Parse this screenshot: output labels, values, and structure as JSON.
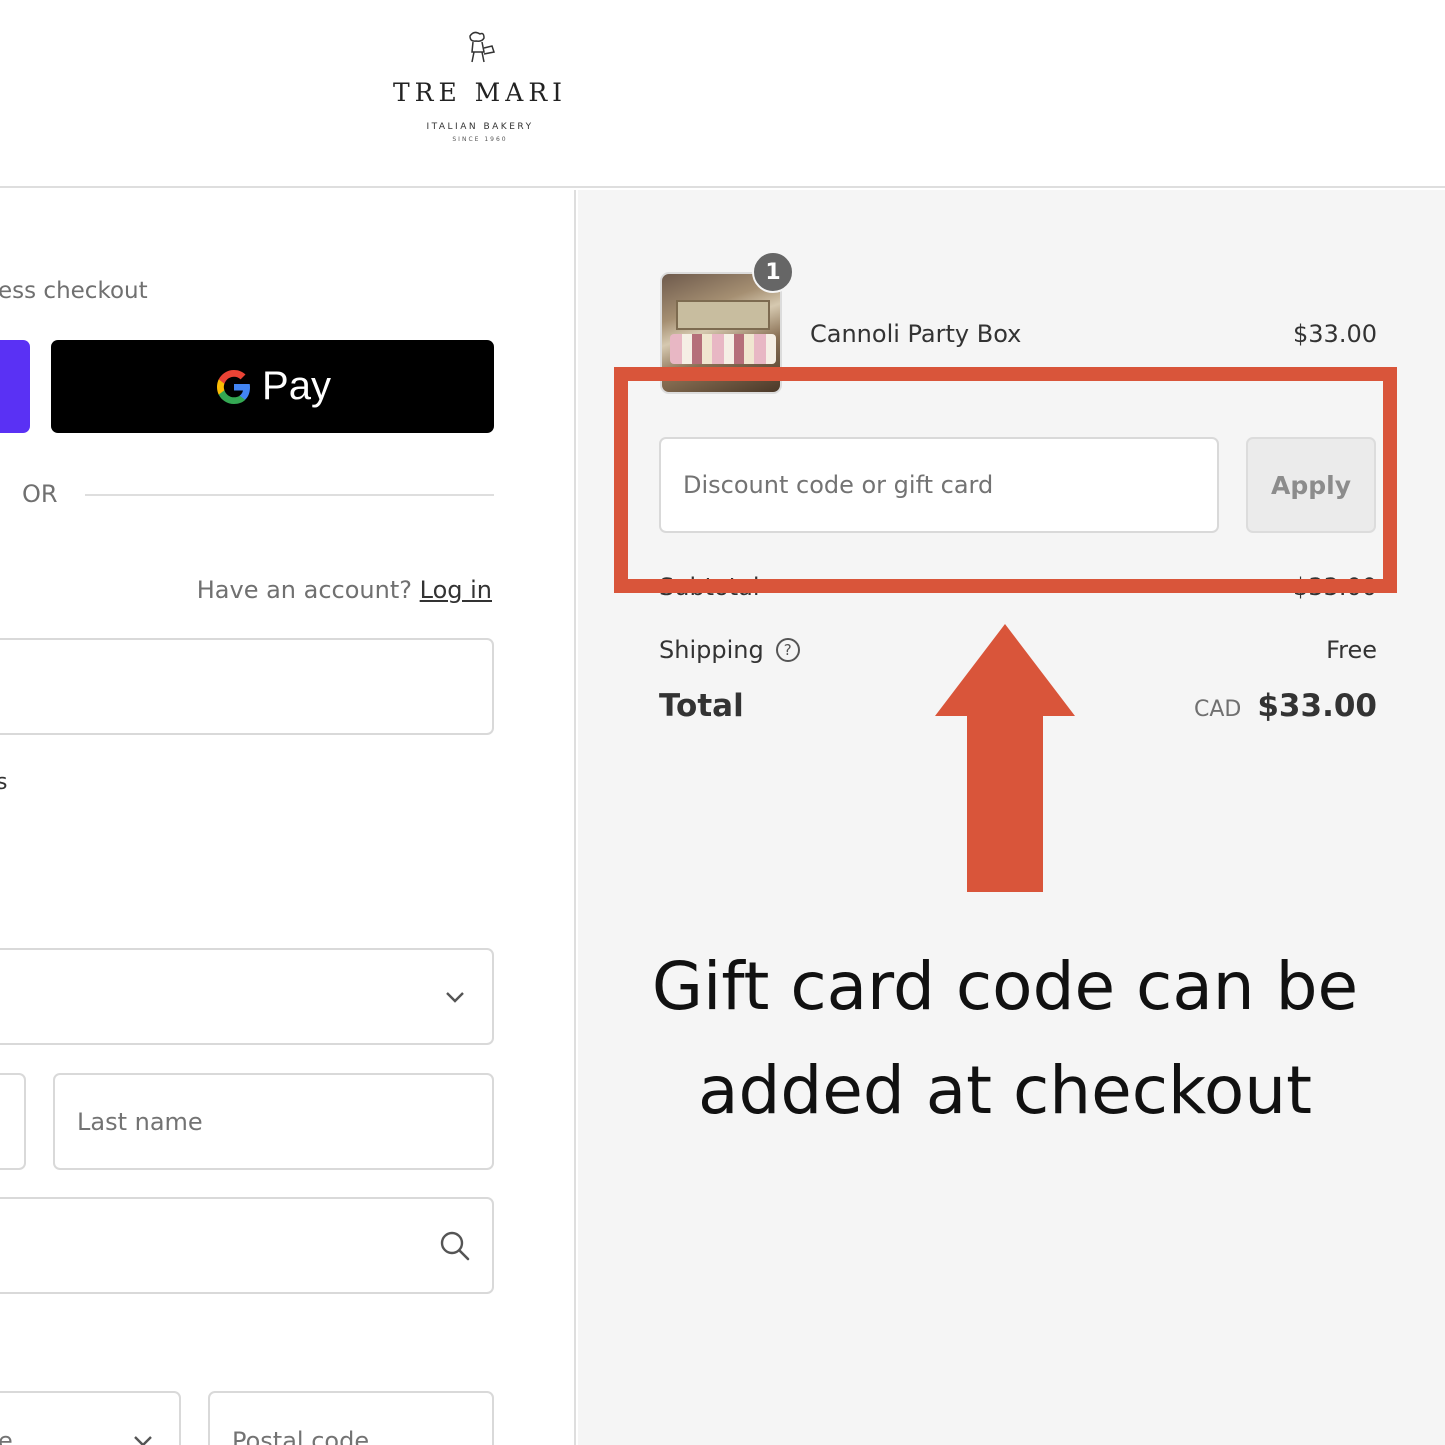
{
  "brand": {
    "name": "TRE MARI",
    "tagline": "ITALIAN BAKERY",
    "since": "SINCE 1960"
  },
  "express": {
    "label": "ess checkout",
    "gpay_label": "Pay"
  },
  "divider": {
    "or_text": "OR"
  },
  "account": {
    "prompt": "Have an account?",
    "login_link": "Log in"
  },
  "form": {
    "stray_text": "s",
    "last_name_placeholder": "Last name",
    "postal_code_placeholder": "Postal code",
    "province_partial": "e"
  },
  "order": {
    "item_name": "Cannoli Party Box",
    "item_price": "$33.00",
    "quantity": "1",
    "discount_placeholder": "Discount code or gift card",
    "apply_label": "Apply",
    "subtotal_label": "Subtotal",
    "subtotal_value": "$33.00",
    "shipping_label": "Shipping",
    "shipping_value": "Free",
    "total_label": "Total",
    "total_currency": "CAD",
    "total_value": "$33.00"
  },
  "annotation": {
    "caption": "Gift card code can be added at checkout",
    "color": "#d9553a"
  },
  "colors": {
    "shop_pay": "#5a31f4",
    "gpay_bg": "#000000",
    "sidebar_bg": "#f5f5f5"
  }
}
